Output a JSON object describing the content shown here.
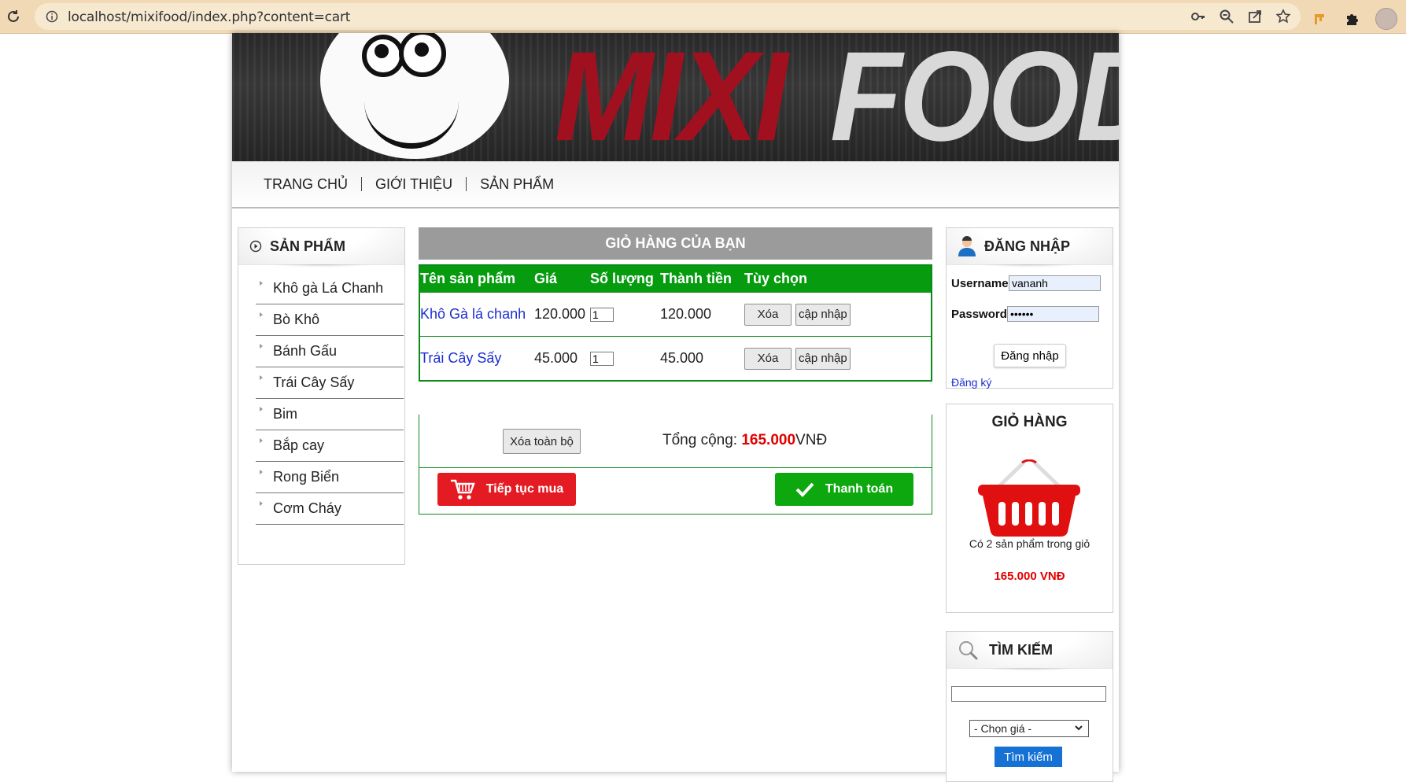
{
  "browser": {
    "url": "localhost/mixifood/index.php?content=cart"
  },
  "banner": {
    "logo_word1": "MIXI",
    "logo_word2": "FOOD"
  },
  "nav": {
    "items": [
      "TRANG CHỦ",
      "GIỚI THIỆU",
      "SẢN PHẨM"
    ]
  },
  "sidebar": {
    "title": "SẢN PHẨM",
    "items": [
      "Khô gà Lá Chanh",
      "Bò Khô",
      "Bánh Gấu",
      "Trái Cây Sấy",
      "Bim",
      "Bắp cay",
      "Rong Biển",
      "Cơm Cháy"
    ]
  },
  "cart": {
    "title": "GIỎ HÀNG CỦA BẠN",
    "columns": [
      "Tên sản phẩm",
      "Giá",
      "Số lượng",
      "Thành tiền",
      "Tùy chọn"
    ],
    "rows": [
      {
        "name": "Khô Gà lá chanh",
        "price": "120.000",
        "qty": "1",
        "subtotal": "120.000"
      },
      {
        "name": "Trái Cây Sấy",
        "price": "45.000",
        "qty": "1",
        "subtotal": "45.000"
      }
    ],
    "delete_label": "Xóa",
    "update_label": "cập nhập",
    "clear_all_label": "Xóa toàn bộ",
    "total_label": "Tổng cộng:",
    "total_amount": "165.000",
    "total_currency": "VNĐ",
    "continue_label": "Tiếp tục mua",
    "checkout_label": "Thanh toán"
  },
  "login": {
    "title": "ĐĂNG NHẬP",
    "username_label": "Username:",
    "username_value": "vananh",
    "password_label": "Password:",
    "password_value": "••••••",
    "submit_label": "Đăng nhập",
    "register_link": "Đăng ký"
  },
  "mini_cart": {
    "title": "GIỎ HÀNG",
    "count_text": "Có 2 sản phẩm trong giỏ",
    "total_text": "165.000 VNĐ"
  },
  "search": {
    "title": "TÌM KIẾM",
    "price_selected": "- Chọn giá -",
    "button_label": "Tìm kiếm"
  },
  "colors": {
    "cart_header": "#079b10",
    "price_red": "#e20000",
    "continue_red": "#e51b23",
    "checkout_green": "#0ca80e",
    "search_blue": "#1572d4"
  }
}
